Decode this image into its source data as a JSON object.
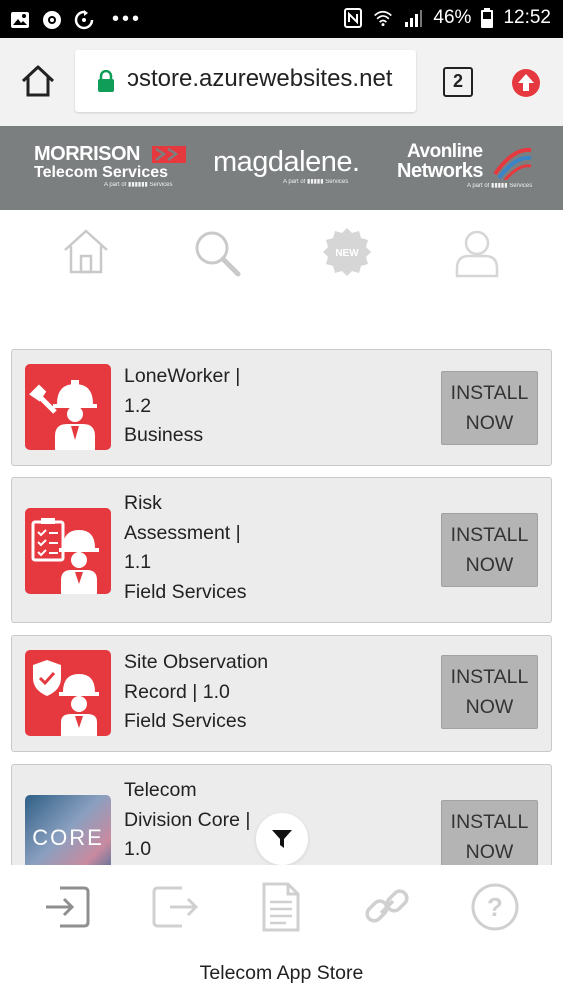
{
  "status_bar": {
    "battery_percent": "46%",
    "time": "12:52"
  },
  "browser": {
    "url": "ɔstore.azurewebsites.net",
    "tab_count": "2"
  },
  "banner": {
    "morrison_line1": "MORRISON",
    "morrison_line2": "Telecom Services",
    "morrison_sub": "A part of ▮▮▮▮▮▮ Services",
    "magdalene": "magdalene.",
    "magdalene_sub": "A part of ▮▮▮▮▮ Services",
    "avonline_line1": "Avonline",
    "avonline_line2": "Networks",
    "avonline_sub": "A part of ▮▮▮▮▮ Services"
  },
  "nav": {
    "icons": [
      "home-icon",
      "search-icon",
      "new-badge-icon",
      "profile-icon"
    ],
    "new_label": "NEW"
  },
  "apps": [
    {
      "lines": [
        "LoneWorker |",
        "1.2",
        "Business"
      ],
      "install_lines": [
        "INSTALL",
        "NOW"
      ],
      "icon": "lone-worker-icon",
      "icon_color": "#e5393f"
    },
    {
      "lines": [
        "Risk",
        "Assessment |",
        "1.1",
        "Field Services"
      ],
      "install_lines": [
        "INSTALL",
        "NOW"
      ],
      "icon": "risk-assessment-icon",
      "icon_color": "#e5393f"
    },
    {
      "lines": [
        "Site Observation",
        "Record | 1.0",
        "Field Services"
      ],
      "install_lines": [
        "INSTALL",
        "NOW"
      ],
      "icon": "site-observation-icon",
      "icon_color": "#e5393f"
    },
    {
      "lines": [
        "Telecom",
        "Division Core |",
        "1.0"
      ],
      "install_lines": [
        "INSTALL",
        "NOW"
      ],
      "icon": "core-app-icon",
      "icon_text": "CORE"
    }
  ],
  "bottom_bar": {
    "icons": [
      "login-icon",
      "logout-icon",
      "document-icon",
      "link-icon",
      "help-icon"
    ],
    "title": "Telecom App Store"
  },
  "colors": {
    "accent_red": "#e5393f",
    "banner_gray": "#7b7f80",
    "card_bg": "#ececec",
    "install_bg": "#b4b4b4"
  }
}
